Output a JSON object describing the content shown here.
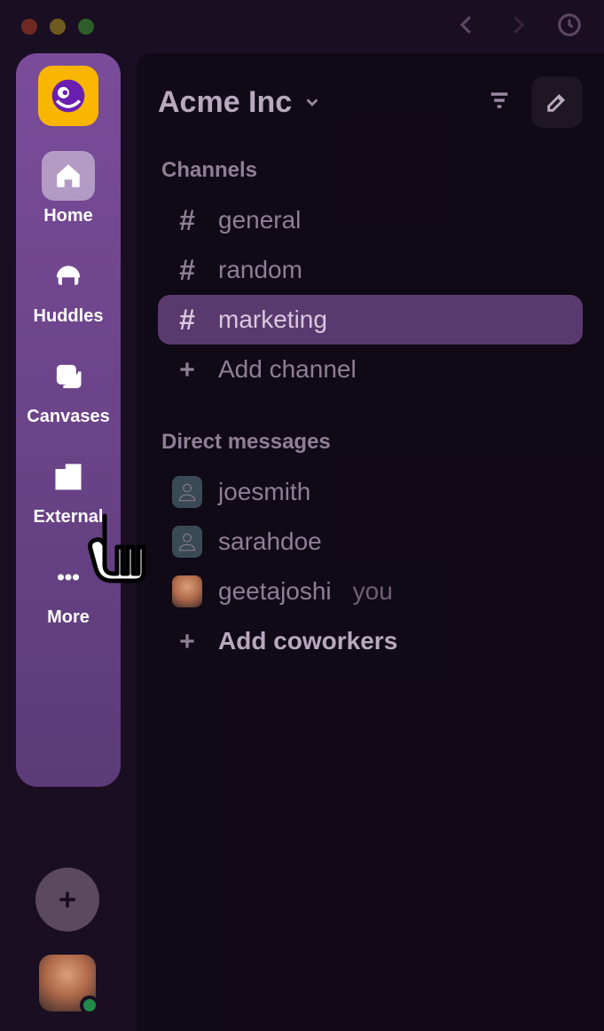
{
  "rail": {
    "items": [
      {
        "id": "home",
        "label": "Home"
      },
      {
        "id": "huddles",
        "label": "Huddles"
      },
      {
        "id": "canvases",
        "label": "Canvases"
      },
      {
        "id": "external",
        "label": "External"
      },
      {
        "id": "more",
        "label": "More"
      }
    ]
  },
  "workspace": {
    "name": "Acme Inc"
  },
  "sections": {
    "channels": {
      "title": "Channels",
      "items": [
        {
          "name": "general"
        },
        {
          "name": "random"
        },
        {
          "name": "marketing",
          "selected": true
        }
      ],
      "add_label": "Add channel"
    },
    "dms": {
      "title": "Direct messages",
      "items": [
        {
          "name": "joesmith"
        },
        {
          "name": "sarahdoe"
        },
        {
          "name": "geetajoshi",
          "you": true,
          "you_label": "you"
        }
      ],
      "add_label": "Add coworkers"
    }
  }
}
